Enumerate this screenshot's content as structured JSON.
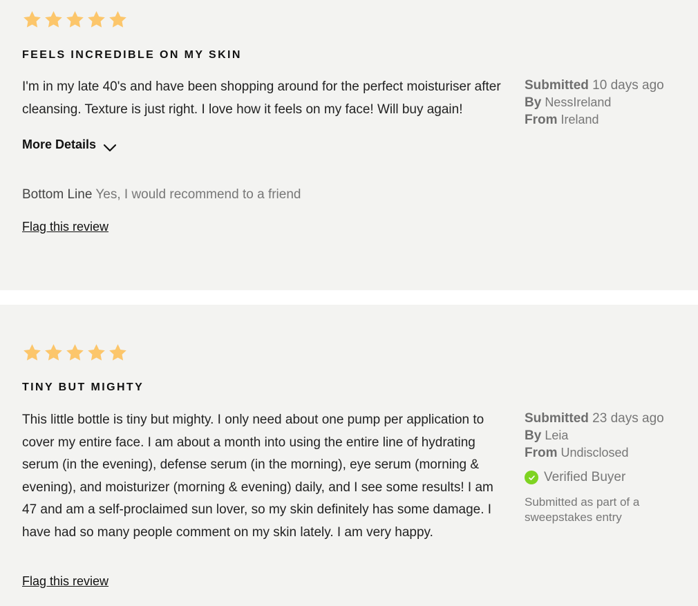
{
  "colors": {
    "card_background": "#f3f3f1",
    "star": "#fcc66b",
    "verified_check": "#7ed321"
  },
  "reviews": [
    {
      "rating": 5,
      "title": "FEELS INCREDIBLE ON MY SKIN",
      "body": "I'm in my late 40's and have been shopping around for the perfect moisturiser after cleansing. Texture is just right. I love how it feels on my face! Will buy again!",
      "more_details_label": "More Details",
      "bottom_line_label": "Bottom Line",
      "bottom_line_value": "Yes, I would recommend to a friend",
      "flag_label": "Flag this review",
      "submitted_label": "Submitted",
      "submitted_value": "10 days ago",
      "by_label": "By",
      "by_value": "NessIreland",
      "from_label": "From",
      "from_value": "Ireland"
    },
    {
      "rating": 5,
      "title": "TINY BUT MIGHTY",
      "body": "This little bottle is tiny but mighty. I only need about one pump per application to cover my entire face. I am about a month into using the entire line of hydrating serum (in the evening), defense serum (in the morning), eye serum (morning & evening), and moisturizer (morning & evening) daily, and I see some results! I am 47 and am a self-proclaimed sun lover, so my skin definitely has some damage. I have had so many people comment on my skin lately. I am very happy.",
      "flag_label": "Flag this review",
      "submitted_label": "Submitted",
      "submitted_value": "23 days ago",
      "by_label": "By",
      "by_value": "Leia",
      "from_label": "From",
      "from_value": "Undisclosed",
      "verified_label": "Verified Buyer",
      "sweepstakes_note": "Submitted as part of a sweepstakes entry"
    }
  ]
}
